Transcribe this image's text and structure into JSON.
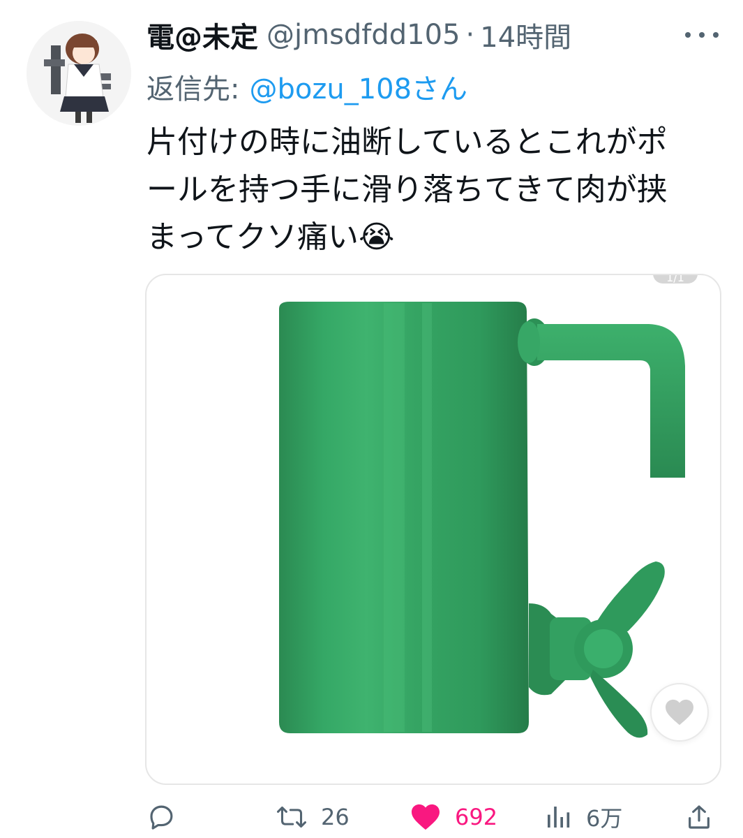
{
  "tweet": {
    "author": {
      "display_name": "電@未定",
      "handle": "@jmsdfdd105",
      "separator": "·",
      "time": "14時間"
    },
    "reply": {
      "label": "返信先:",
      "mention": "@bozu_108さん"
    },
    "text_lines": [
      "片付けの時に油断しているとこれがポ",
      "ールを持つ手に滑り落ちてきて肉が挟",
      "まってクソ痛い😭"
    ],
    "media": {
      "counter": "1/1"
    },
    "actions": {
      "reply_icon": "reply-icon",
      "retweet_icon": "retweet-icon",
      "retweets": "26",
      "like_icon": "heart-icon",
      "likes": "692",
      "views_icon": "views-icon",
      "views": "6万",
      "share_icon": "share-icon"
    }
  },
  "colors": {
    "accent": "#1d9bf0",
    "like": "#f91880",
    "muted": "#536471",
    "pipe_green": "#2f9a5c"
  }
}
